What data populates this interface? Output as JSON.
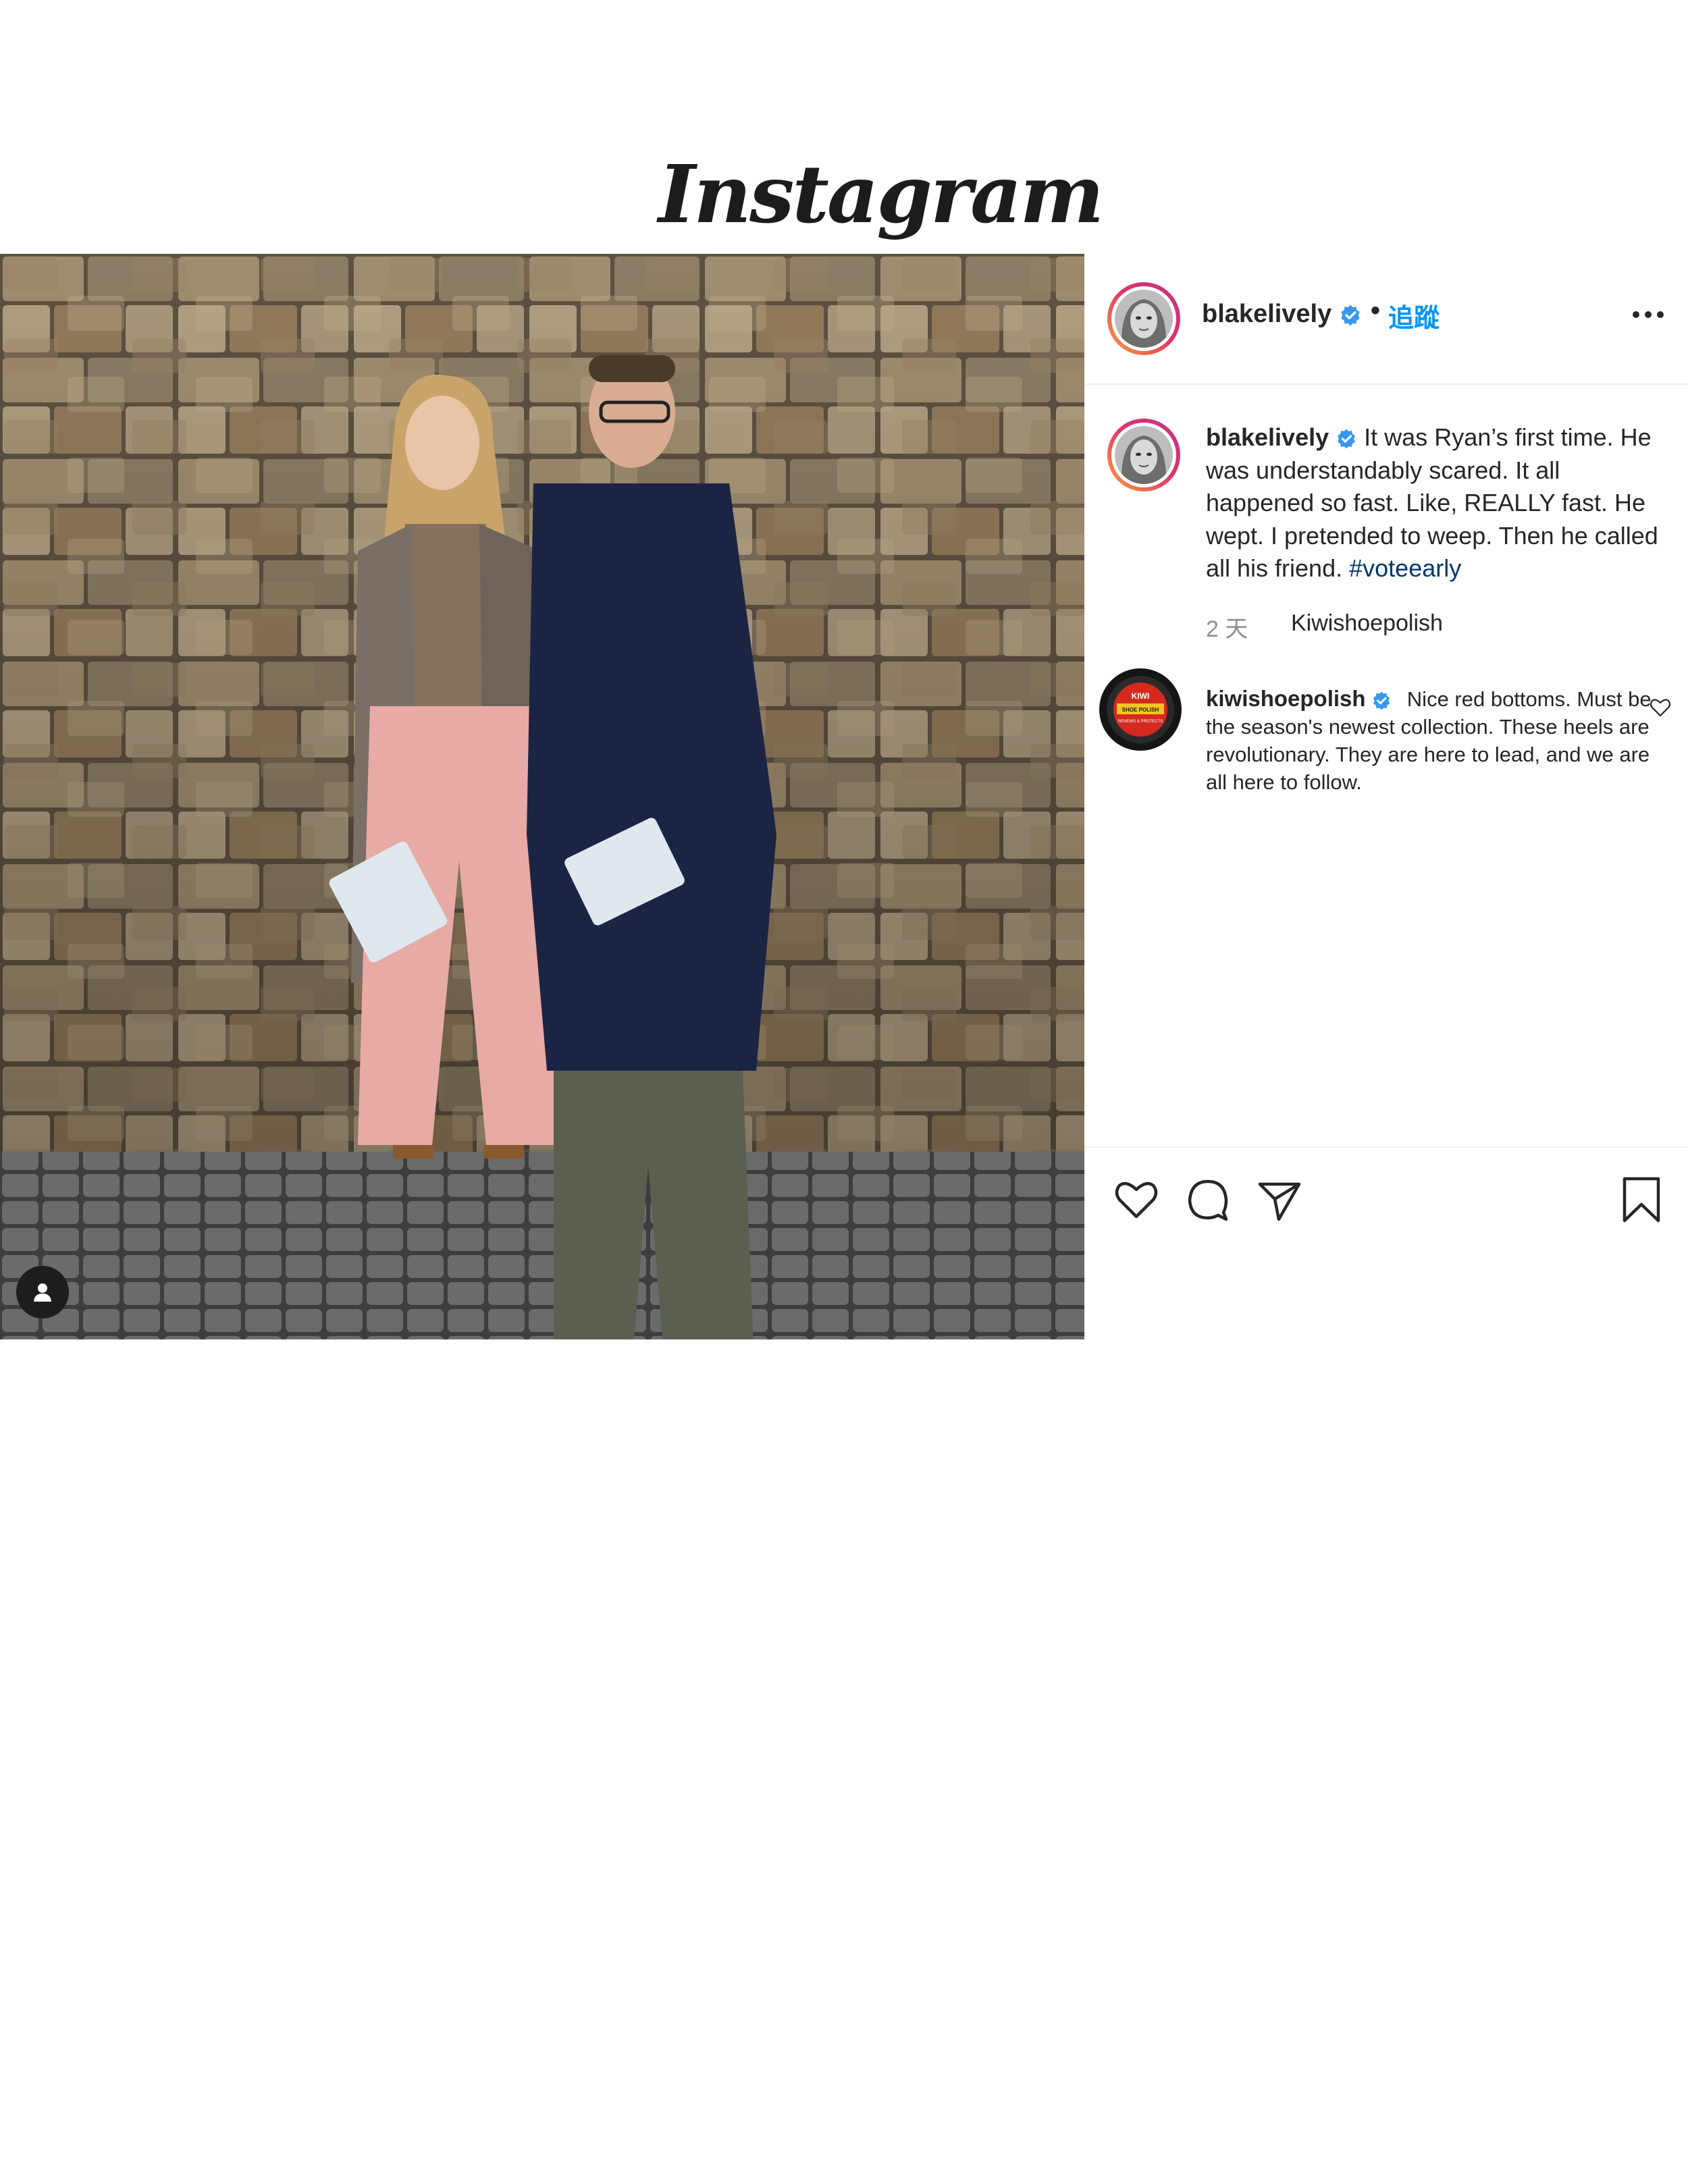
{
  "brand": {
    "logo_text": "Instagram"
  },
  "post": {
    "author": "blakelively",
    "follow_label": "追蹤",
    "separator": "•",
    "caption": {
      "username": "blakelively",
      "text": "It was Ryan’s first time. He was understandably scared. It all happened so fast. Like, REALLY fast. He wept. I pretended to weep. Then he called all his friend.",
      "hashtag": "#voteearly"
    },
    "time_ago": "2 天",
    "reply_link": "Kiwishoepolish"
  },
  "comments": [
    {
      "username": "kiwishoepolish",
      "text": "Nice red bottoms. Must be the season's newest collection. These heels are revolutionary. They are here to lead, and we are all here to follow."
    }
  ],
  "kiwi_tin": {
    "brand": "KIWI",
    "label": "SHOE POLISH",
    "sub": "RENEWS & PROTECTS"
  },
  "icons": [
    "verified-badge-icon",
    "more-options-icon",
    "user-tag-icon",
    "heart-icon",
    "comment-icon",
    "share-icon",
    "bookmark-icon"
  ],
  "colors": {
    "follow": "#0095f6",
    "hashtag": "#00376b",
    "verified": "#3897f0",
    "muted": "#8e8e8e",
    "text": "#262626"
  }
}
